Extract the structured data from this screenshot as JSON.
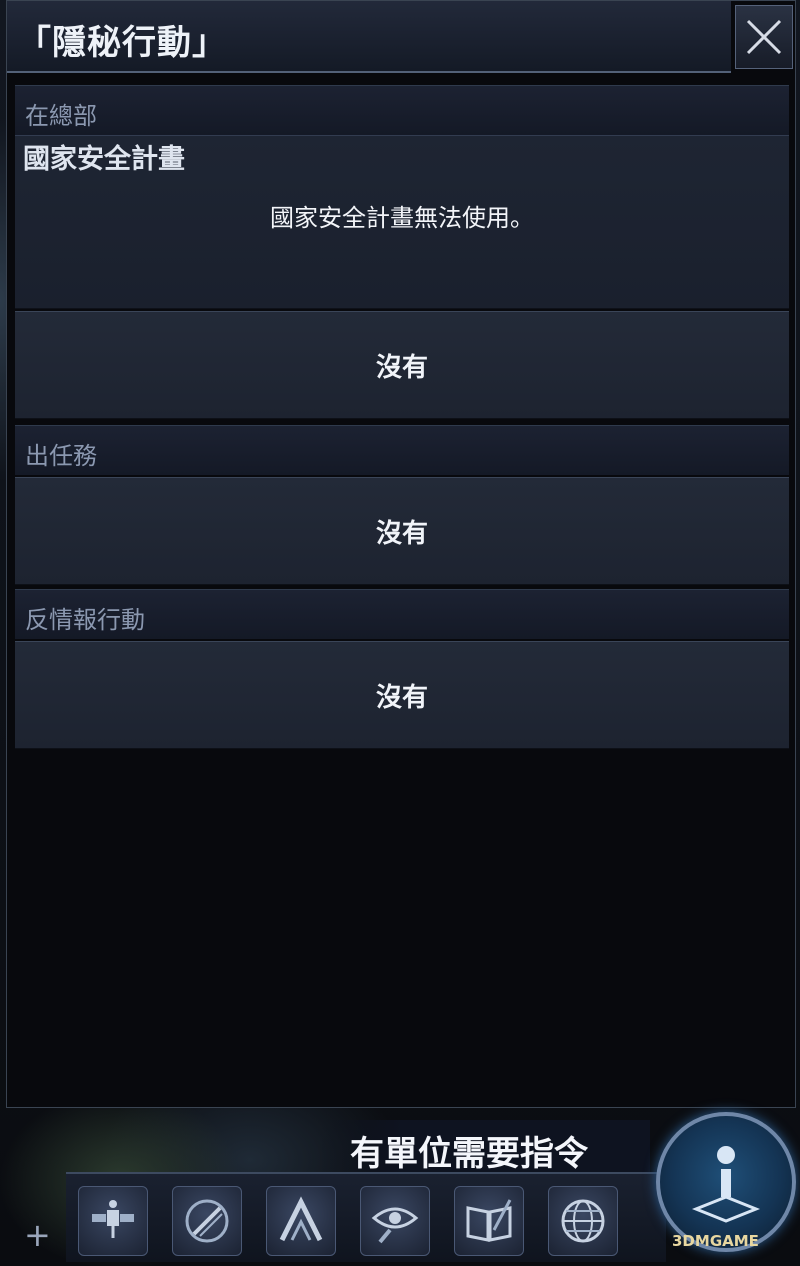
{
  "window": {
    "title": "「隱秘行動」"
  },
  "headquarters": {
    "header": "在總部",
    "subtitle": "國家安全計畫",
    "message": "國家安全計畫無法使用。",
    "action_label": "沒有"
  },
  "missions": {
    "header": "出任務",
    "action_label": "沒有"
  },
  "counterintel": {
    "header": "反情報行動",
    "action_label": "沒有"
  },
  "bottom_bar": {
    "status_text": "有單位需要指令",
    "watermark": "3DMGAME",
    "tools": [
      "satellite-icon",
      "crossed-swords-icon",
      "chevron-up-icon",
      "eye-search-icon",
      "book-quill-icon",
      "globe-icon"
    ],
    "expand_symbol": "+",
    "accent": "#6f87a8"
  }
}
